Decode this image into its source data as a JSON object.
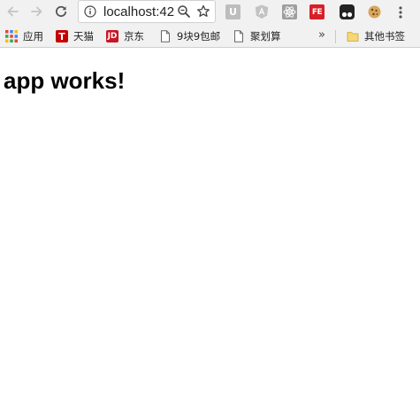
{
  "browser": {
    "address_text": "localhost:42",
    "nav": {
      "back_icon": "arrow-left-icon",
      "forward_icon": "arrow-right-icon",
      "reload_icon": "reload-icon"
    },
    "extensions": [
      {
        "name": "u-extension",
        "label": "U"
      },
      {
        "name": "angular-extension",
        "label": ""
      },
      {
        "name": "react-extension",
        "label": ""
      },
      {
        "name": "fe-extension",
        "label": "FE"
      },
      {
        "name": "tampermonkey-extension",
        "label": ""
      },
      {
        "name": "cookie-extension",
        "label": ""
      }
    ]
  },
  "bookmarks": {
    "apps_label": "应用",
    "tmall_label": "天猫",
    "tmall_icon_text": "T",
    "jd_label": "京东",
    "jd_icon_text": "JD",
    "item9_label": "9块9包邮",
    "juhuasuan_label": "聚划算",
    "more_label": "»",
    "other_label": "其他书签"
  },
  "page": {
    "heading": "app works!"
  },
  "colors": {
    "toolbar_bg": "#f1f1f1",
    "tmall_red": "#c40000",
    "jd_red": "#c91623",
    "fe_red": "#d81f27"
  }
}
